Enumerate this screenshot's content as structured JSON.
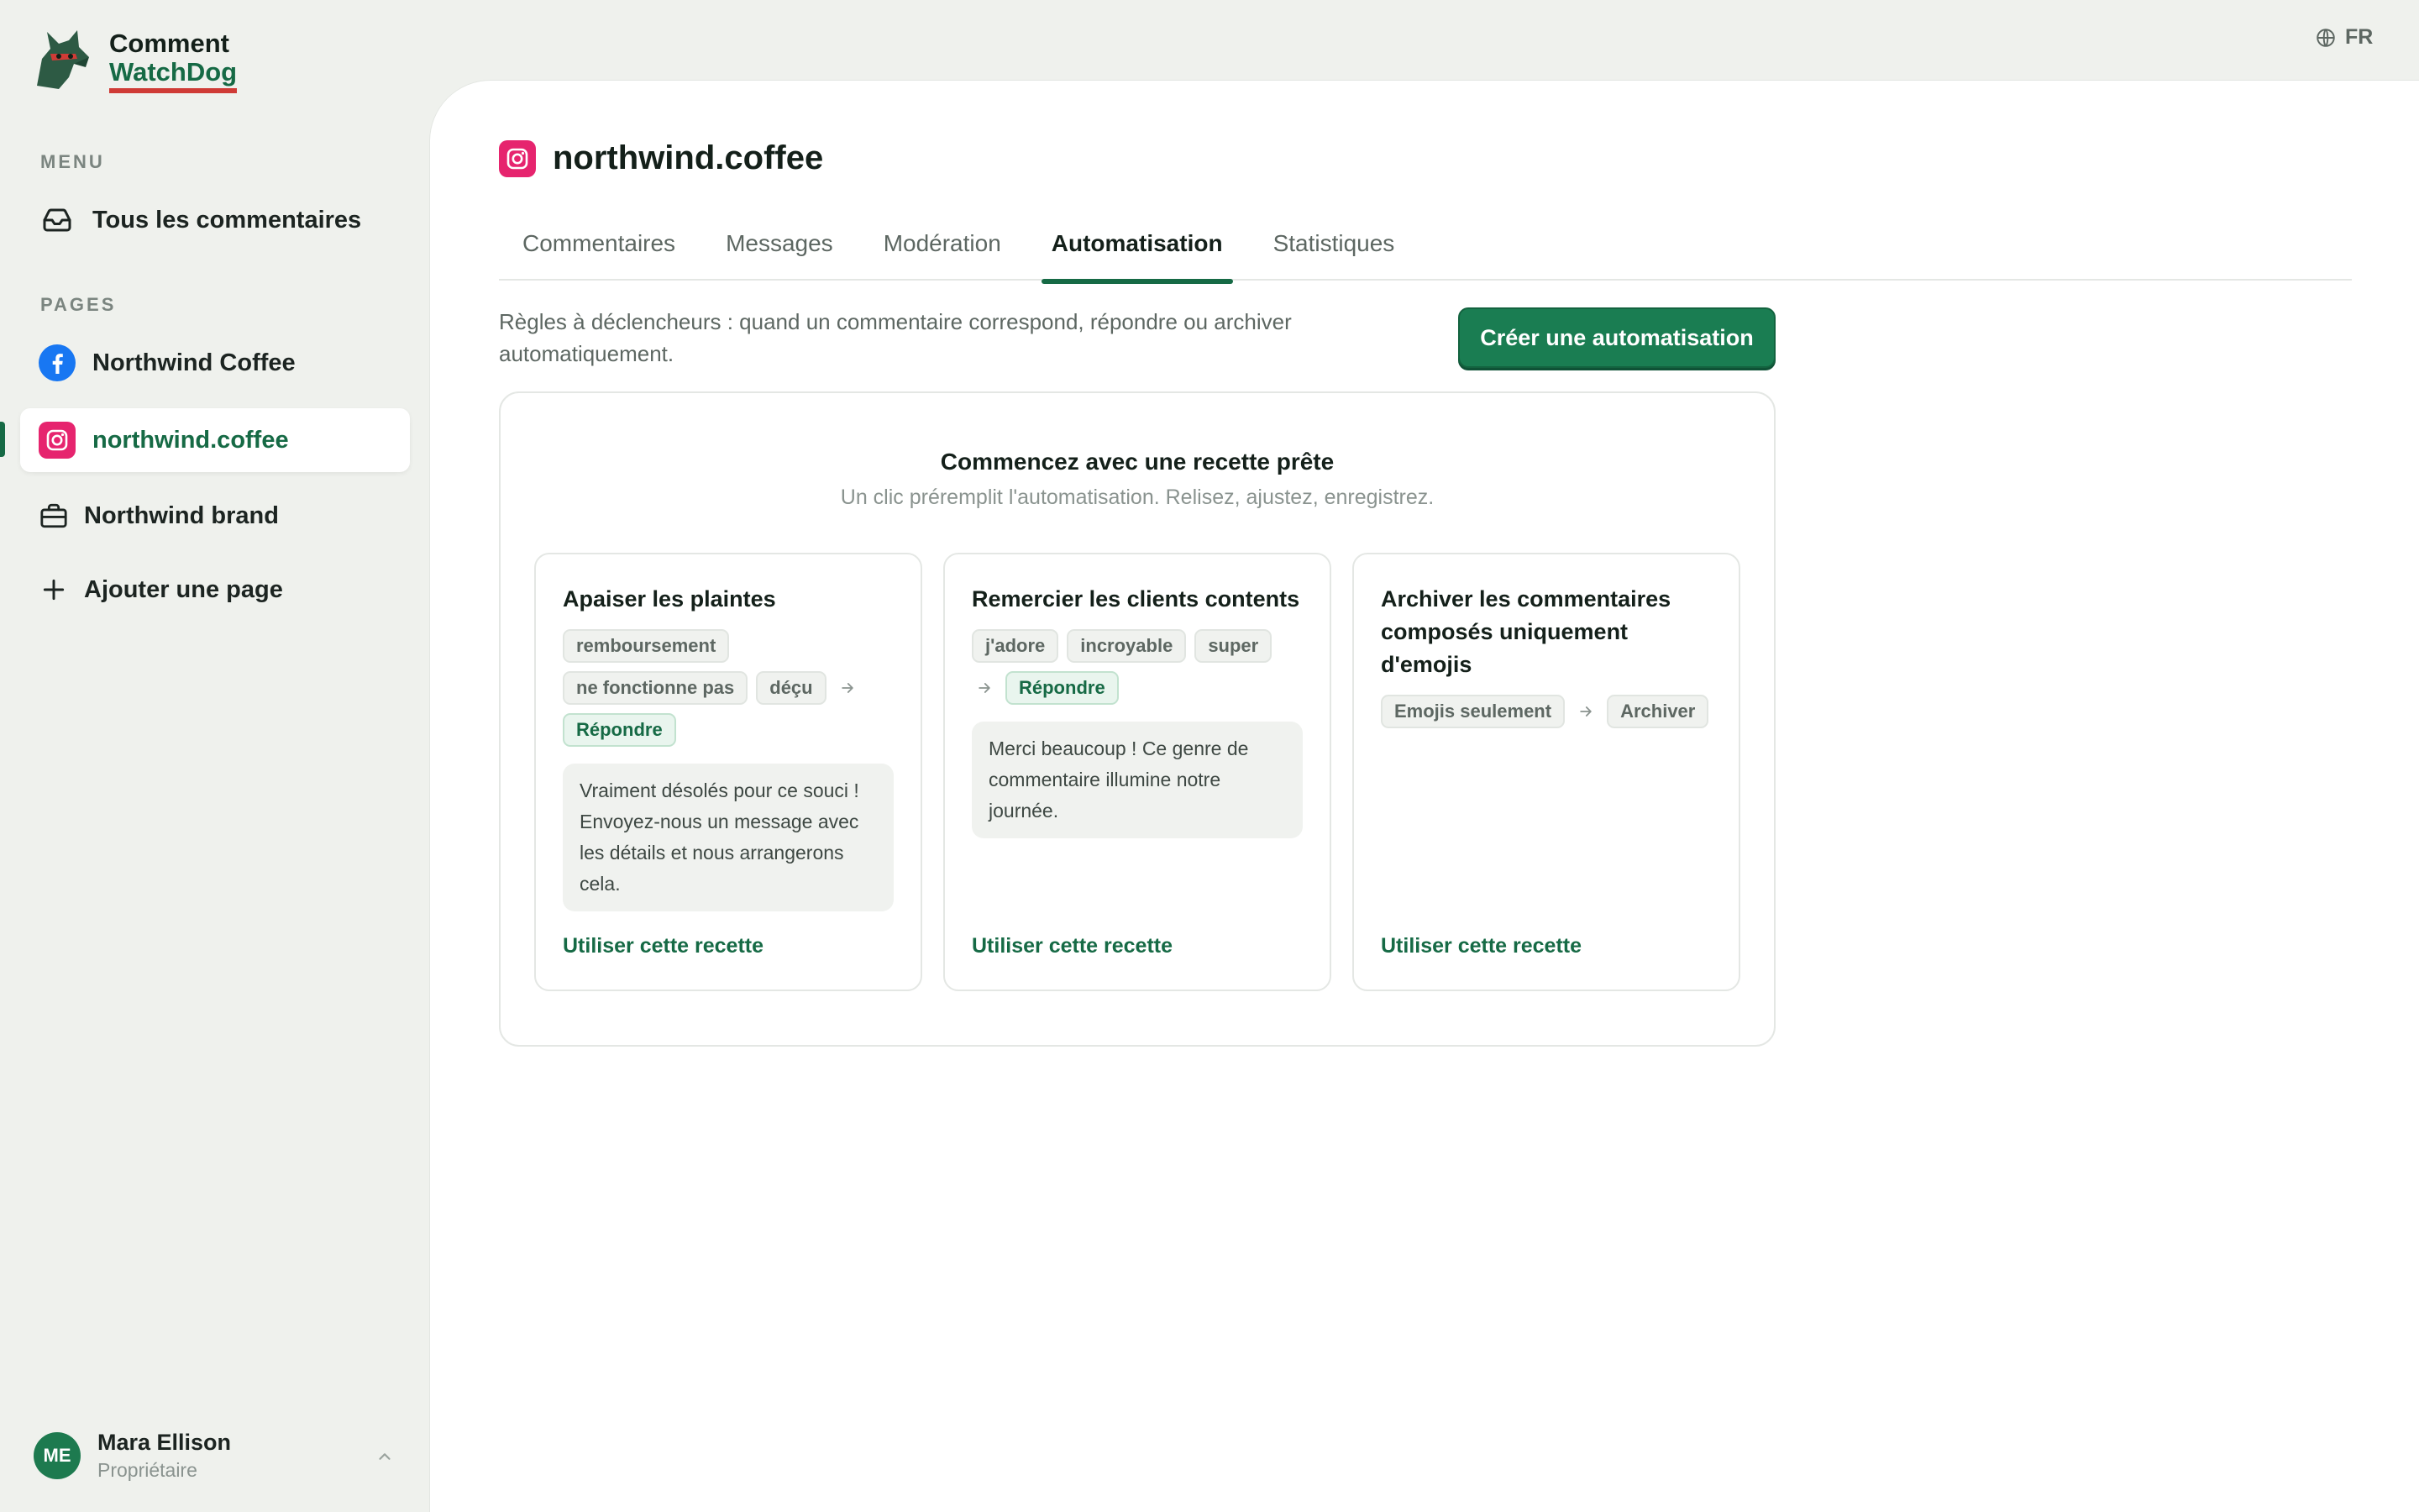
{
  "brand": {
    "line1": "Comment",
    "line2": "WatchDog"
  },
  "language": {
    "label": "FR"
  },
  "sidebar": {
    "menu_label": "MENU",
    "all_comments": "Tous les commentaires",
    "pages_label": "PAGES",
    "pages": [
      {
        "label": "Northwind Coffee",
        "icon": "facebook-icon"
      },
      {
        "label": "northwind.coffee",
        "icon": "instagram-icon",
        "active": true
      },
      {
        "label": "Northwind brand",
        "icon": "briefcase-icon"
      }
    ],
    "add_page": "Ajouter une page"
  },
  "user": {
    "initials": "ME",
    "name": "Mara Ellison",
    "role": "Propriétaire"
  },
  "page": {
    "title": "northwind.coffee"
  },
  "tabs": [
    {
      "label": "Commentaires"
    },
    {
      "label": "Messages"
    },
    {
      "label": "Modération"
    },
    {
      "label": "Automatisation",
      "active": true
    },
    {
      "label": "Statistiques"
    }
  ],
  "automation": {
    "description": "Règles à déclencheurs : quand un commentaire correspond, répondre ou archiver automatiquement.",
    "create_button": "Créer une automatisation",
    "recipes_title": "Commencez avec une recette prête",
    "recipes_subtitle": "Un clic préremplit l'automatisation. Relisez, ajustez, enregistrez.",
    "recipes": [
      {
        "title": "Apaiser les plaintes",
        "triggers": [
          "remboursement",
          "ne fonctionne pas",
          "déçu"
        ],
        "action": "Répondre",
        "reply": "Vraiment désolés pour ce souci ! Envoyez-nous un message avec les détails et nous arrangerons cela.",
        "link": "Utiliser cette recette"
      },
      {
        "title": "Remercier les clients contents",
        "triggers": [
          "j'adore",
          "incroyable",
          "super"
        ],
        "action": "Répondre",
        "reply": "Merci beaucoup ! Ce genre de commentaire illumine notre journée.",
        "link": "Utiliser cette recette"
      },
      {
        "title": "Archiver les commentaires composés uniquement d'emojis",
        "triggers": [
          "Emojis seulement"
        ],
        "action": "Archiver",
        "link": "Utiliser cette recette"
      }
    ]
  },
  "colors": {
    "brand_green": "#166a45",
    "button_green": "#1a7d52",
    "instagram": "#e6246e",
    "facebook": "#1877f2",
    "accent_red": "#cf3b36"
  }
}
